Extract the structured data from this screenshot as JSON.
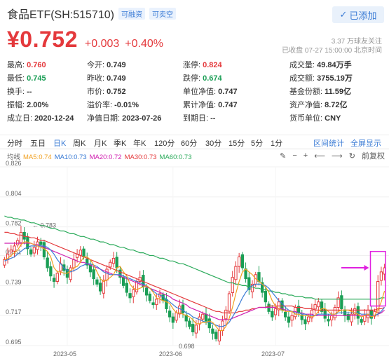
{
  "header": {
    "title": "食品ETF(SH:515710)",
    "tags": [
      "可融资",
      "可卖空"
    ],
    "watch_label": "已添加",
    "price": "¥0.752",
    "change": "+0.003",
    "change_pct": "+0.40%",
    "followers": "3.37 万球友关注",
    "status_line": "已收盘 07-27 15:00:00 北京时间"
  },
  "stats": {
    "r1": [
      {
        "label": "最高: ",
        "value": "0.760",
        "tone": "up"
      },
      {
        "label": "今开: ",
        "value": "0.749",
        "tone": ""
      },
      {
        "label": "涨停: ",
        "value": "0.824",
        "tone": "up"
      },
      {
        "label": "成交量: ",
        "value": "49.84万手",
        "tone": ""
      }
    ],
    "r2": [
      {
        "label": "最低: ",
        "value": "0.745",
        "tone": "down"
      },
      {
        "label": "昨收: ",
        "value": "0.749",
        "tone": ""
      },
      {
        "label": "跌停: ",
        "value": "0.674",
        "tone": "down"
      },
      {
        "label": "成交额: ",
        "value": "3755.19万",
        "tone": ""
      }
    ],
    "r3": [
      {
        "label": "换手: ",
        "value": "--",
        "tone": ""
      },
      {
        "label": "市价: ",
        "value": "0.752",
        "tone": ""
      },
      {
        "label": "单位净值: ",
        "value": "0.747",
        "tone": ""
      },
      {
        "label": "基金份额: ",
        "value": "11.59亿",
        "tone": ""
      }
    ],
    "r4": [
      {
        "label": "振幅: ",
        "value": "2.00%",
        "tone": ""
      },
      {
        "label": "溢价率: ",
        "value": "-0.01%",
        "tone": ""
      },
      {
        "label": "累计净值: ",
        "value": "0.747",
        "tone": ""
      },
      {
        "label": "资产净值: ",
        "value": "8.72亿",
        "tone": ""
      }
    ],
    "r5": [
      {
        "label": "成立日: ",
        "value": "2020-12-24",
        "tone": ""
      },
      {
        "label": "净值日期: ",
        "value": "2023-07-26",
        "tone": ""
      },
      {
        "label": "到期日: ",
        "value": "--",
        "tone": ""
      },
      {
        "label": "货币单位: ",
        "value": "CNY",
        "tone": ""
      }
    ]
  },
  "tabs": [
    "分时",
    "五日",
    "日K",
    "周K",
    "月K",
    "季K",
    "年K",
    "120分",
    "60分",
    "30分",
    "15分",
    "5分",
    "1分"
  ],
  "active_tab": "日K",
  "tab_links": {
    "interval": "区间统计",
    "fullscreen": "全屏显示"
  },
  "ma": {
    "base_label": "均线",
    "items": [
      {
        "label": "MA5:0.74",
        "color": "#f0a020"
      },
      {
        "label": "MA10:0.73",
        "color": "#3a7bd5"
      },
      {
        "label": "MA20:0.72",
        "color": "#d020b0"
      },
      {
        "label": "MA30:0.73",
        "color": "#e4393c"
      },
      {
        "label": "MA60:0.73",
        "color": "#2aaa5a"
      }
    ],
    "adjust_label": "前复权"
  },
  "colors": {
    "up": "#e4393c",
    "down": "#1a9e55",
    "accent": "#3a7bd5",
    "highlight": "#e020e0"
  },
  "chart_data": {
    "type": "candlestick",
    "yticks": [
      "0.826",
      "0.804",
      "0.782",
      "0.761",
      "0.739",
      "0.717",
      "0.695"
    ],
    "xticks": [
      "2023-05",
      "2023-06",
      "2023-07"
    ],
    "ylim": [
      0.695,
      0.826
    ],
    "annotations": {
      "high": "0.783",
      "low": "0.698"
    },
    "closes": [
      0.758,
      0.762,
      0.765,
      0.768,
      0.772,
      0.778,
      0.773,
      0.766,
      0.762,
      0.767,
      0.771,
      0.769,
      0.76,
      0.752,
      0.746,
      0.742,
      0.748,
      0.755,
      0.75,
      0.745,
      0.752,
      0.758,
      0.762,
      0.765,
      0.76,
      0.754,
      0.749,
      0.744,
      0.74,
      0.735,
      0.743,
      0.751,
      0.756,
      0.759,
      0.752,
      0.745,
      0.739,
      0.734,
      0.73,
      0.736,
      0.742,
      0.745,
      0.738,
      0.732,
      0.728,
      0.725,
      0.729,
      0.733,
      0.728,
      0.722,
      0.716,
      0.712,
      0.719,
      0.724,
      0.719,
      0.713,
      0.709,
      0.705,
      0.71,
      0.716,
      0.718,
      0.713,
      0.708,
      0.704,
      0.7,
      0.706,
      0.713,
      0.721,
      0.733,
      0.745,
      0.753,
      0.76,
      0.752,
      0.744,
      0.736,
      0.74,
      0.747,
      0.742,
      0.734,
      0.727,
      0.72,
      0.716,
      0.722,
      0.727,
      0.721,
      0.716,
      0.712,
      0.717,
      0.723,
      0.719,
      0.714,
      0.711,
      0.716,
      0.721,
      0.725,
      0.727,
      0.72,
      0.715,
      0.713,
      0.717,
      0.723,
      0.73,
      0.722,
      0.717,
      0.714,
      0.718,
      0.722,
      0.715,
      0.712,
      0.717,
      0.721,
      0.715,
      0.72,
      0.742,
      0.749,
      0.752
    ],
    "ma5": [
      0.758,
      0.759,
      0.761,
      0.763,
      0.765,
      0.769,
      0.771,
      0.771,
      0.77,
      0.769,
      0.768,
      0.767,
      0.766,
      0.764,
      0.76,
      0.752,
      0.749,
      0.749,
      0.748,
      0.748,
      0.75,
      0.752,
      0.753,
      0.756,
      0.76,
      0.76,
      0.758,
      0.754,
      0.749,
      0.744,
      0.742,
      0.743,
      0.745,
      0.747,
      0.752,
      0.753,
      0.749,
      0.746,
      0.74,
      0.737,
      0.736,
      0.737,
      0.738,
      0.739,
      0.737,
      0.734,
      0.73,
      0.729,
      0.728,
      0.727,
      0.726,
      0.722,
      0.719,
      0.719,
      0.718,
      0.717,
      0.716,
      0.714,
      0.711,
      0.711,
      0.712,
      0.712,
      0.713,
      0.712,
      0.709,
      0.706,
      0.706,
      0.709,
      0.715,
      0.723,
      0.733,
      0.742,
      0.749,
      0.751,
      0.749,
      0.747,
      0.744,
      0.742,
      0.74,
      0.738,
      0.734,
      0.728,
      0.724,
      0.722,
      0.721,
      0.72,
      0.72,
      0.72,
      0.718,
      0.718,
      0.717,
      0.717,
      0.717,
      0.716,
      0.717,
      0.72,
      0.722,
      0.722,
      0.72,
      0.718,
      0.718,
      0.72,
      0.721,
      0.721,
      0.721,
      0.72,
      0.719,
      0.718,
      0.716,
      0.717,
      0.718,
      0.716,
      0.717,
      0.721,
      0.727,
      0.735
    ],
    "ma10": [
      0.757,
      0.758,
      0.759,
      0.76,
      0.762,
      0.764,
      0.766,
      0.767,
      0.768,
      0.768,
      0.768,
      0.768,
      0.768,
      0.767,
      0.765,
      0.762,
      0.758,
      0.755,
      0.752,
      0.75,
      0.749,
      0.75,
      0.751,
      0.753,
      0.754,
      0.755,
      0.755,
      0.754,
      0.753,
      0.751,
      0.749,
      0.748,
      0.747,
      0.747,
      0.747,
      0.747,
      0.746,
      0.745,
      0.744,
      0.743,
      0.742,
      0.741,
      0.74,
      0.739,
      0.737,
      0.735,
      0.733,
      0.732,
      0.731,
      0.729,
      0.727,
      0.725,
      0.723,
      0.722,
      0.721,
      0.719,
      0.718,
      0.716,
      0.715,
      0.714,
      0.713,
      0.712,
      0.712,
      0.711,
      0.71,
      0.709,
      0.709,
      0.71,
      0.712,
      0.716,
      0.72,
      0.725,
      0.73,
      0.734,
      0.737,
      0.739,
      0.74,
      0.74,
      0.74,
      0.739,
      0.737,
      0.734,
      0.731,
      0.728,
      0.726,
      0.723,
      0.721,
      0.72,
      0.719,
      0.719,
      0.718,
      0.718,
      0.717,
      0.717,
      0.717,
      0.718,
      0.718,
      0.718,
      0.718,
      0.718,
      0.718,
      0.719,
      0.719,
      0.719,
      0.719,
      0.719,
      0.719,
      0.719,
      0.718,
      0.718,
      0.718,
      0.717,
      0.717,
      0.718,
      0.72,
      0.723
    ],
    "ma20": [
      0.77,
      0.77,
      0.77,
      0.77,
      0.77,
      0.77,
      0.77,
      0.77,
      0.77,
      0.769,
      0.769,
      0.768,
      0.767,
      0.766,
      0.765,
      0.764,
      0.763,
      0.762,
      0.761,
      0.76,
      0.759,
      0.758,
      0.757,
      0.756,
      0.756,
      0.755,
      0.754,
      0.753,
      0.752,
      0.751,
      0.75,
      0.749,
      0.748,
      0.747,
      0.747,
      0.746,
      0.745,
      0.744,
      0.743,
      0.742,
      0.741,
      0.74,
      0.739,
      0.738,
      0.737,
      0.736,
      0.735,
      0.734,
      0.733,
      0.732,
      0.731,
      0.729,
      0.728,
      0.727,
      0.726,
      0.725,
      0.723,
      0.722,
      0.721,
      0.72,
      0.719,
      0.718,
      0.717,
      0.716,
      0.715,
      0.714,
      0.714,
      0.714,
      0.714,
      0.715,
      0.716,
      0.717,
      0.718,
      0.719,
      0.72,
      0.721,
      0.722,
      0.723,
      0.723,
      0.723,
      0.723,
      0.723,
      0.723,
      0.722,
      0.722,
      0.721,
      0.721,
      0.72,
      0.72,
      0.719,
      0.719,
      0.718,
      0.718,
      0.718,
      0.717,
      0.717,
      0.717,
      0.717,
      0.717,
      0.717,
      0.717,
      0.717,
      0.717,
      0.717,
      0.717,
      0.717,
      0.717,
      0.717,
      0.717,
      0.717,
      0.717,
      0.717,
      0.717,
      0.718,
      0.719,
      0.721
    ],
    "ma30": [
      0.778,
      0.778,
      0.777,
      0.777,
      0.776,
      0.776,
      0.775,
      0.775,
      0.774,
      0.774,
      0.773,
      0.772,
      0.772,
      0.771,
      0.77,
      0.769,
      0.768,
      0.767,
      0.766,
      0.765,
      0.764,
      0.763,
      0.762,
      0.761,
      0.76,
      0.759,
      0.758,
      0.757,
      0.756,
      0.755,
      0.754,
      0.753,
      0.752,
      0.751,
      0.75,
      0.749,
      0.748,
      0.747,
      0.746,
      0.745,
      0.744,
      0.743,
      0.742,
      0.741,
      0.74,
      0.739,
      0.738,
      0.737,
      0.736,
      0.735,
      0.734,
      0.733,
      0.732,
      0.731,
      0.73,
      0.729,
      0.728,
      0.727,
      0.726,
      0.725,
      0.724,
      0.723,
      0.722,
      0.721,
      0.72,
      0.72,
      0.719,
      0.719,
      0.719,
      0.719,
      0.719,
      0.72,
      0.72,
      0.721,
      0.721,
      0.722,
      0.722,
      0.723,
      0.723,
      0.723,
      0.724,
      0.724,
      0.724,
      0.724,
      0.724,
      0.724,
      0.724,
      0.724,
      0.723,
      0.723,
      0.723,
      0.722,
      0.722,
      0.722,
      0.721,
      0.721,
      0.721,
      0.721,
      0.721,
      0.721,
      0.721,
      0.721,
      0.721,
      0.721,
      0.721,
      0.721,
      0.721,
      0.721,
      0.721,
      0.721,
      0.721,
      0.721,
      0.721,
      0.722,
      0.722,
      0.723
    ],
    "ma60": [
      0.79,
      0.789,
      0.789,
      0.788,
      0.788,
      0.787,
      0.787,
      0.786,
      0.785,
      0.785,
      0.784,
      0.783,
      0.783,
      0.782,
      0.781,
      0.781,
      0.78,
      0.779,
      0.779,
      0.778,
      0.777,
      0.777,
      0.776,
      0.775,
      0.775,
      0.774,
      0.773,
      0.773,
      0.772,
      0.771,
      0.771,
      0.77,
      0.769,
      0.769,
      0.768,
      0.767,
      0.767,
      0.766,
      0.765,
      0.765,
      0.764,
      0.763,
      0.763,
      0.762,
      0.761,
      0.761,
      0.76,
      0.759,
      0.759,
      0.758,
      0.757,
      0.757,
      0.756,
      0.755,
      0.755,
      0.754,
      0.753,
      0.752,
      0.751,
      0.75,
      0.749,
      0.748,
      0.747,
      0.746,
      0.745,
      0.744,
      0.743,
      0.742,
      0.741,
      0.741,
      0.74,
      0.74,
      0.739,
      0.739,
      0.738,
      0.738,
      0.737,
      0.737,
      0.736,
      0.736,
      0.735,
      0.735,
      0.734,
      0.734,
      0.733,
      0.733,
      0.732,
      0.732,
      0.731,
      0.731,
      0.731,
      0.73,
      0.73,
      0.73,
      0.729,
      0.729,
      0.729,
      0.729,
      0.729,
      0.729,
      0.729,
      0.729,
      0.729,
      0.729,
      0.729,
      0.729,
      0.729,
      0.729,
      0.729,
      0.729,
      0.729,
      0.729,
      0.729,
      0.729,
      0.73,
      0.73
    ]
  }
}
